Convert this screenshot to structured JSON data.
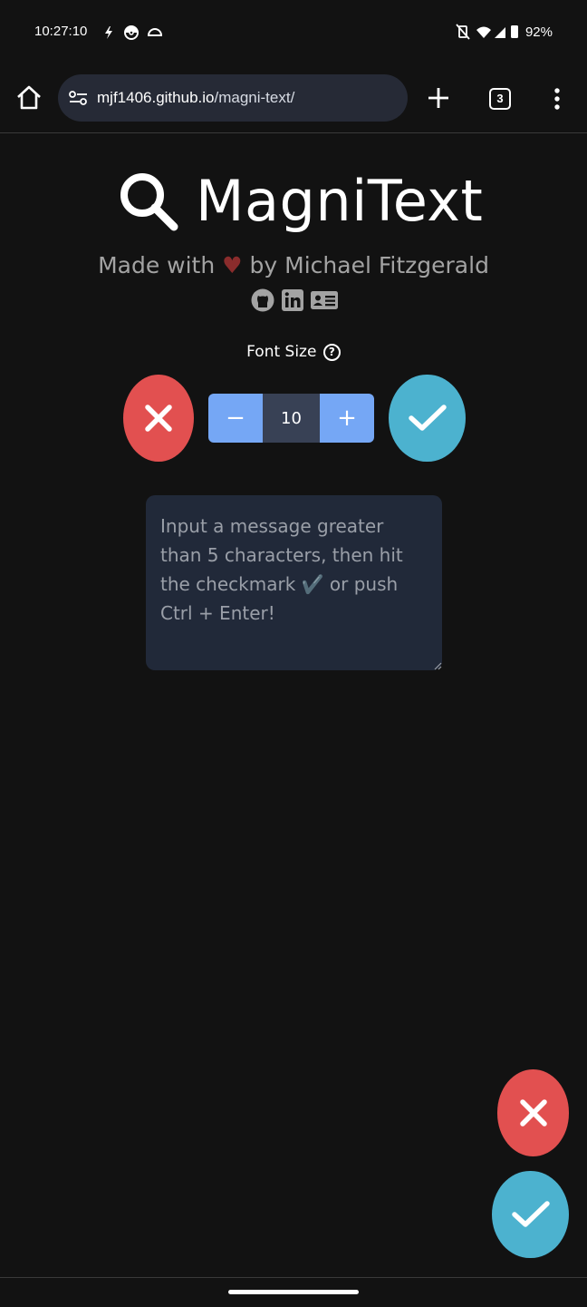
{
  "status_bar": {
    "time": "10:27:10",
    "battery": "92%",
    "left_icons": [
      "flash-icon",
      "pokeball-icon",
      "cloud-icon"
    ],
    "right_icons": [
      "vibrate-off-icon",
      "wifi-icon",
      "signal-icon",
      "battery-icon"
    ]
  },
  "browser": {
    "url_host": "mjf1406.github.io",
    "url_path": "/magni-text/",
    "tab_count": "3"
  },
  "app": {
    "title": "MagniText",
    "byline_prefix": "Made with",
    "heart": "♥",
    "byline_suffix": "by Michael Fitzgerald",
    "font_size_label": "Font Size",
    "help_symbol": "?",
    "font_size_value": "10",
    "decrement_label": "−",
    "increment_label": "+",
    "message_placeholder": "Input a message greater than 5 characters, then hit the checkmark ✔️ or push Ctrl + Enter!",
    "social_icons": [
      "github-icon",
      "linkedin-icon",
      "contact-card-icon"
    ]
  },
  "colors": {
    "clear": "#e25050",
    "submit": "#4cb2cf",
    "stepper": "#75a7f5",
    "background": "#121212"
  }
}
